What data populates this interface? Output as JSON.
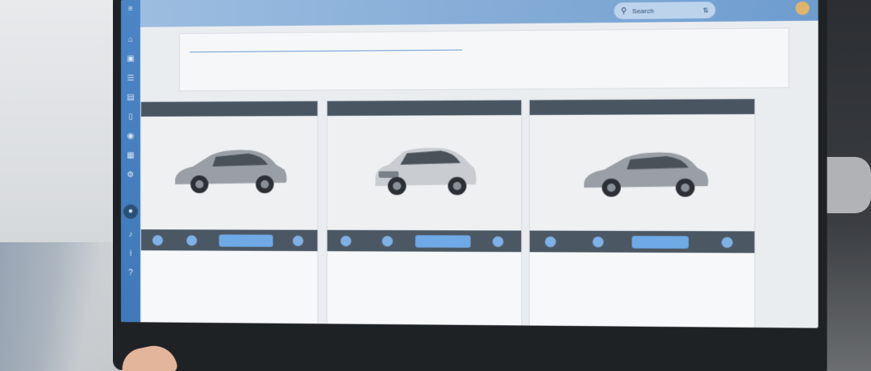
{
  "topbar": {
    "search_label": "Search"
  },
  "compare": {
    "title": "",
    "right_title": "",
    "subtitle": "",
    "stats": [
      {
        "label": "",
        "value": ""
      },
      {
        "label": "",
        "value": ""
      },
      {
        "label": "",
        "value": ""
      },
      {
        "label": "",
        "value": ""
      },
      {
        "label": "",
        "value": ""
      },
      {
        "label": "",
        "value": ""
      }
    ]
  },
  "cars": [
    {
      "name": "",
      "body_color": "#9a9fa5",
      "action_label": "",
      "specs_left": [
        "",
        "",
        "",
        "",
        ""
      ],
      "specs_right": [
        "",
        "",
        "",
        "",
        ""
      ],
      "link": "",
      "price": ""
    },
    {
      "name": "",
      "body_color": "#c9ccd0",
      "action_label": "",
      "specs_left": [
        "",
        "",
        "",
        "",
        ""
      ],
      "specs_right": [
        "",
        "",
        "",
        "",
        ""
      ],
      "link": "",
      "price": ""
    },
    {
      "name": "",
      "body_color": "#9a9fa5",
      "action_label": "",
      "specs_left": [
        "",
        "",
        "",
        "",
        ""
      ],
      "specs_right": [
        "",
        "",
        "",
        "",
        ""
      ],
      "link": "",
      "price": ""
    }
  ],
  "colors": {
    "sidebar": "#4b85c5",
    "accent": "#6fa9e6",
    "card_header": "#4a5562"
  }
}
